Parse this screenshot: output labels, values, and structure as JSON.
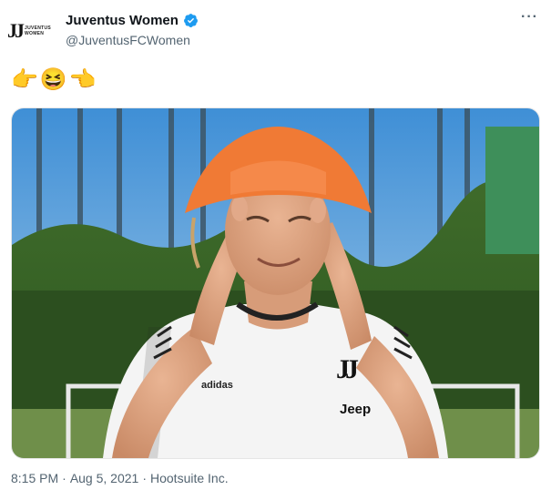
{
  "account": {
    "display_name": "Juventus Women",
    "handle": "@JuventusFCWomen",
    "avatar_mark": "JJ",
    "avatar_word_1": "JUVENTUS",
    "avatar_word_2": "WOMEN"
  },
  "tweet": {
    "text_emojis": [
      "👉",
      "😆",
      "👈"
    ],
    "time": "8:15 PM",
    "dot": "·",
    "date": "Aug 5, 2021",
    "source": "Hootsuite Inc.",
    "more_label": "···"
  },
  "photo": {
    "shirt_crest": "JJ",
    "shirt_sponsor": "Jeep",
    "shirt_brand": "adidas"
  },
  "colors": {
    "verified": "#1d9bf0",
    "hat": "#f07a35",
    "shirt": "#f4f4f4"
  }
}
